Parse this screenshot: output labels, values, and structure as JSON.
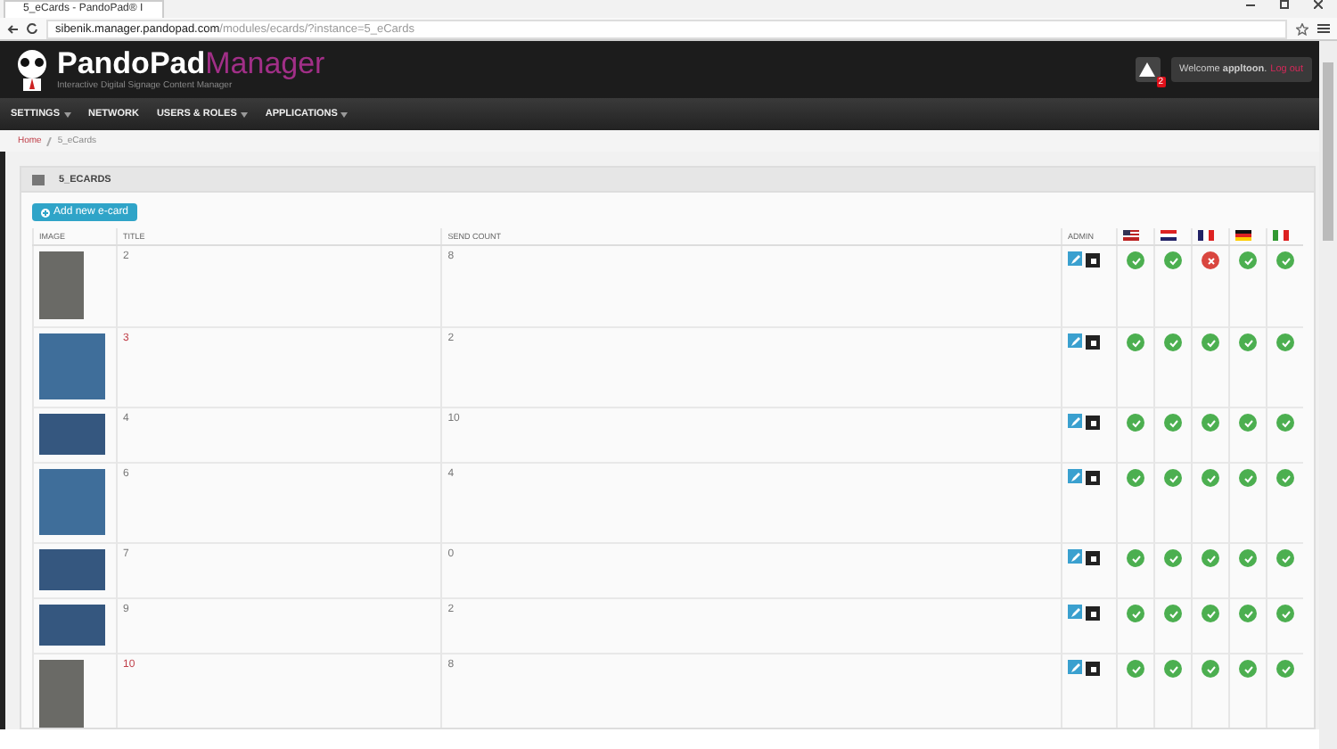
{
  "browser": {
    "tab_title": "5_eCards - PandoPad® I",
    "url_host": "sibenik.manager.pandopad.com",
    "url_path": "/modules/ecards/?instance=5_eCards"
  },
  "header": {
    "logo_main": "PandoPad",
    "logo_accent": "Manager",
    "tagline": "Interactive Digital Signage Content Manager",
    "alert_count": "2",
    "welcome": "Welcome **appltoon**.",
    "logout": "Log out"
  },
  "nav": [
    {
      "label": "SETTINGS",
      "dropdown": true
    },
    {
      "label": "NETWORK",
      "dropdown": false
    },
    {
      "label": "USERS & ROLES",
      "dropdown": true
    },
    {
      "label": "APPLICATIONS",
      "dropdown": true
    }
  ],
  "breadcrumb": [
    "Home",
    "5_eCards"
  ],
  "panel": {
    "title": "5_ECARDS",
    "add_button": "Add new e-card"
  },
  "table": {
    "columns": [
      {
        "kind": "text",
        "label": "IMAGE"
      },
      {
        "kind": "text",
        "label": "TITLE"
      },
      {
        "kind": "text",
        "label": "SEND COUNT"
      },
      {
        "kind": "text",
        "label": "ADMIN"
      },
      {
        "kind": "flag"
      },
      {
        "kind": "flag"
      },
      {
        "kind": "flag"
      },
      {
        "kind": "flag"
      },
      {
        "kind": "flag"
      }
    ],
    "rows": [
      {
        "title": "2",
        "visited": false,
        "send_count": "8",
        "translated": [
          true,
          true,
          false,
          true,
          true
        ]
      },
      {
        "title": "3",
        "visited": true,
        "send_count": "2",
        "translated": [
          true,
          true,
          true,
          true,
          true
        ]
      },
      {
        "title": "4",
        "visited": false,
        "send_count": "10",
        "translated": [
          true,
          true,
          true,
          true,
          true
        ]
      },
      {
        "title": "6",
        "visited": false,
        "send_count": "4",
        "translated": [
          true,
          true,
          true,
          true,
          true
        ]
      },
      {
        "title": "7",
        "visited": false,
        "send_count": "0",
        "translated": [
          true,
          true,
          true,
          true,
          true
        ]
      },
      {
        "title": "9",
        "visited": false,
        "send_count": "2",
        "translated": [
          true,
          true,
          true,
          true,
          true
        ]
      },
      {
        "title": "10",
        "visited": true,
        "send_count": "8",
        "translated": [
          true,
          true,
          true,
          true,
          true
        ]
      }
    ]
  }
}
